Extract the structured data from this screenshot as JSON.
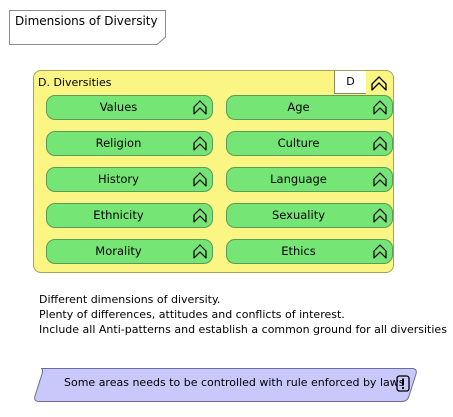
{
  "note": {
    "title": "Dimensions of Diversity"
  },
  "group": {
    "title": "D. Diversities",
    "tag": "D",
    "icon": "grouping-icon",
    "items": [
      {
        "label": "Values"
      },
      {
        "label": "Age"
      },
      {
        "label": "Religion"
      },
      {
        "label": "Culture"
      },
      {
        "label": "History"
      },
      {
        "label": "Language"
      },
      {
        "label": "Ethnicity"
      },
      {
        "label": "Sexuality"
      },
      {
        "label": "Morality"
      },
      {
        "label": "Ethics"
      }
    ]
  },
  "description": {
    "lines": [
      "Different dimensions of diversity.",
      "Plenty of differences, attitudes and conflicts of interest.",
      "Include all Anti-patterns and establish a common ground for all diversities"
    ]
  },
  "constraint": {
    "text": "Some areas needs to be controlled with rule enforced by laws",
    "icon": "exclamation-box-icon"
  },
  "colors": {
    "group_fill": "#fbf683",
    "item_fill": "#75e675",
    "constraint_fill": "#c8c8fa"
  }
}
